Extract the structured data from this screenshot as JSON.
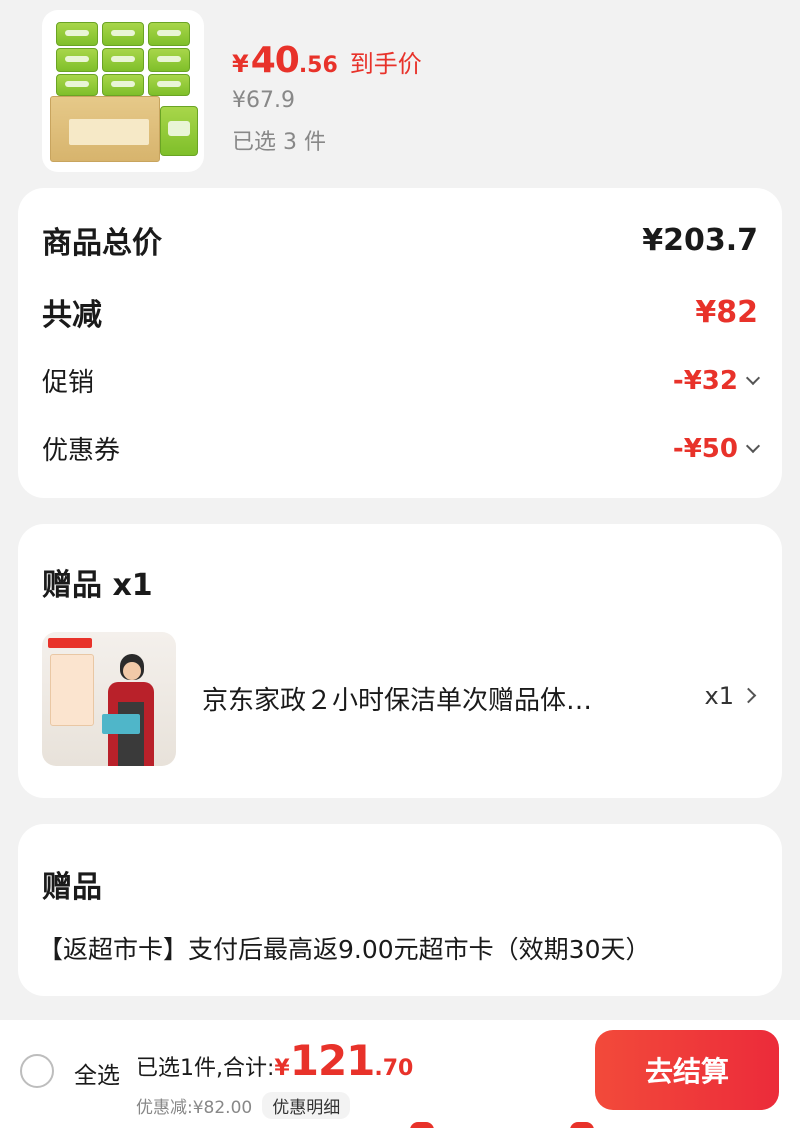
{
  "product": {
    "price_yen": "¥",
    "price_int": "40",
    "price_dec": ".56",
    "price_tag": "到手价",
    "original_price": "¥67.9",
    "selected_count": "已选 3 件",
    "thumb_icon": "tissue-pack-image"
  },
  "summary": {
    "total_label": "商品总价",
    "total_value": "¥203.7",
    "reduce_label": "共减",
    "reduce_value": "¥82",
    "promo_label": "促销",
    "promo_value": "-¥32",
    "coupon_label": "优惠券",
    "coupon_value": "-¥50"
  },
  "gift": {
    "title": "赠品 x1",
    "name": "京东家政２小时保洁单次赠品体…",
    "qty": "x1",
    "thumb_icon": "housekeeping-service-image"
  },
  "gift2": {
    "title": "赠品",
    "desc": "【返超市卡】支付后最高返9.00元超市卡（效期30天）"
  },
  "bottom": {
    "select_all": "全选",
    "total_prefix": "已选1件,合计:",
    "total_yen": "¥",
    "total_int": "121",
    "total_dec": ".70",
    "discount_text": "优惠减:¥82.00",
    "discount_detail": "优惠明细",
    "checkout": "去结算"
  },
  "colors": {
    "accent_red": "#e8322a",
    "background": "#f2f2f2",
    "muted_text": "#888888"
  }
}
